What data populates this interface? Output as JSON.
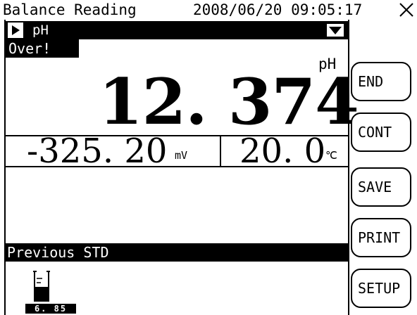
{
  "title_bar": {
    "title": "Balance Reading",
    "datetime": "2008/06/20 09:05:17",
    "close_icon": "close-icon"
  },
  "channel": {
    "label": "pH",
    "play_icon": "play-icon",
    "dropdown_icon": "dropdown-icon"
  },
  "status": {
    "badge": "Over!"
  },
  "reading": {
    "value": "12. 374",
    "unit": "pH"
  },
  "sub_readings": {
    "potential_value": "-325. 20",
    "potential_unit": "mV",
    "temperature_value": "20. 0",
    "temperature_unit": "℃"
  },
  "previous_std": {
    "label": "Previous STD",
    "icon": "beaker-icon",
    "value": "6. 85"
  },
  "buttons": [
    {
      "label": "END"
    },
    {
      "label": "CONT"
    },
    {
      "label": "SAVE"
    },
    {
      "label": "PRINT"
    },
    {
      "label": "SETUP"
    }
  ],
  "colors": {
    "foreground": "#000000",
    "background": "#ffffff"
  }
}
